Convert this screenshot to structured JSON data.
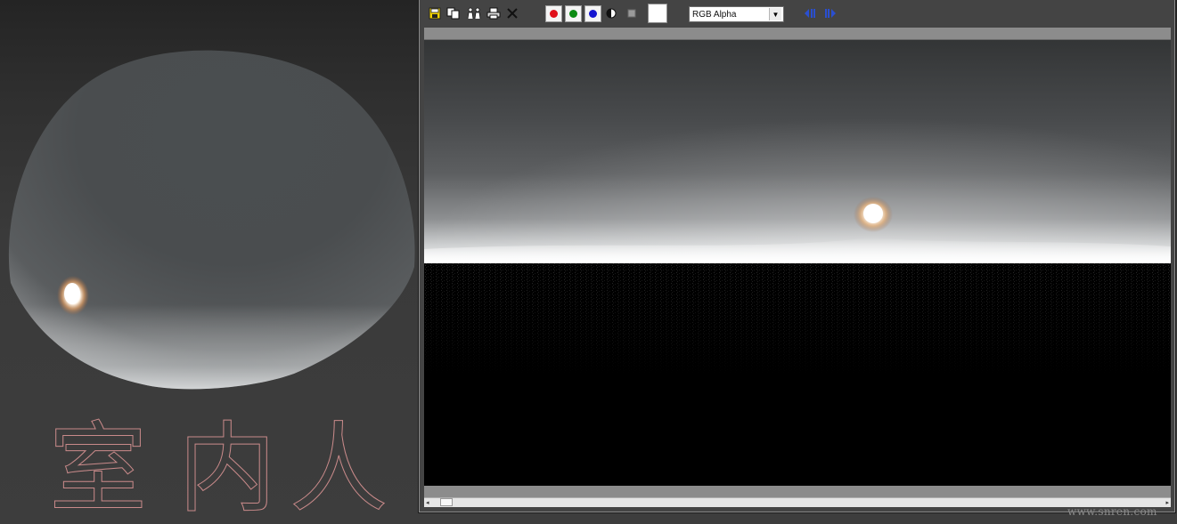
{
  "viewport": {
    "watermark_characters": [
      "室",
      "内",
      "人"
    ]
  },
  "frame_buffer": {
    "toolbar": {
      "icons": [
        "save-image-icon",
        "clone-window-icon",
        "print-icon",
        "clear-icon"
      ],
      "channel_buttons": [
        {
          "name": "red-channel",
          "color": "#e0101a"
        },
        {
          "name": "green-channel",
          "color": "#0b8a12"
        },
        {
          "name": "blue-channel",
          "color": "#1414d0"
        }
      ],
      "channel_display_select": "RGB Alpha"
    }
  },
  "site_watermark": "www.snren.com"
}
